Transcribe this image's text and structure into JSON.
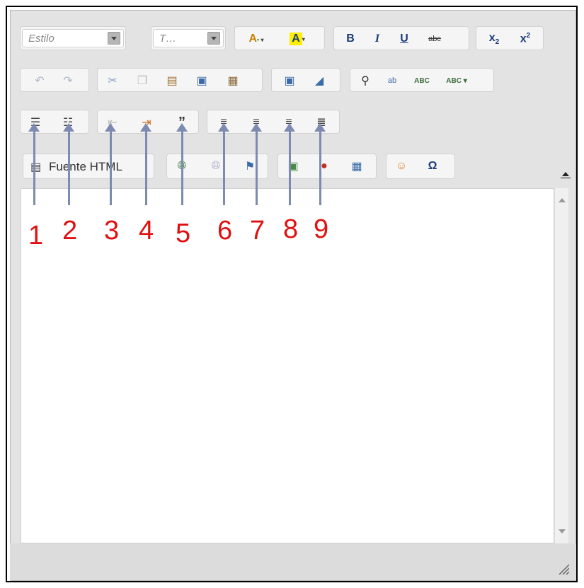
{
  "toolbar": {
    "style_combo": {
      "placeholder": "Estilo"
    },
    "size_combo": {
      "placeholder": "T…"
    },
    "source_button": {
      "label": "Fuente HTML"
    },
    "row1_buttons": [
      "text-color",
      "bg-color",
      "bold",
      "italic",
      "underline",
      "strikethrough",
      "subscript",
      "superscript"
    ],
    "row2_buttons": [
      "undo",
      "redo",
      "cut",
      "copy",
      "paste",
      "paste-text",
      "paste-word",
      "select-all",
      "remove-format",
      "find",
      "replace",
      "spellcheck",
      "spellcheck-menu"
    ],
    "row3_buttons": [
      "numbered-list",
      "bulleted-list",
      "decrease-indent",
      "increase-indent",
      "blockquote",
      "align-left",
      "align-center",
      "align-right",
      "justify"
    ],
    "row4_buttons": [
      "link",
      "unlink",
      "anchor",
      "image",
      "flash",
      "table",
      "smiley",
      "special-char"
    ]
  },
  "annotations": {
    "labels": [
      "1",
      "2",
      "3",
      "4",
      "5",
      "6",
      "7",
      "8",
      "9"
    ],
    "color": "#e01010",
    "arrow_color": "#7d8bb0"
  }
}
